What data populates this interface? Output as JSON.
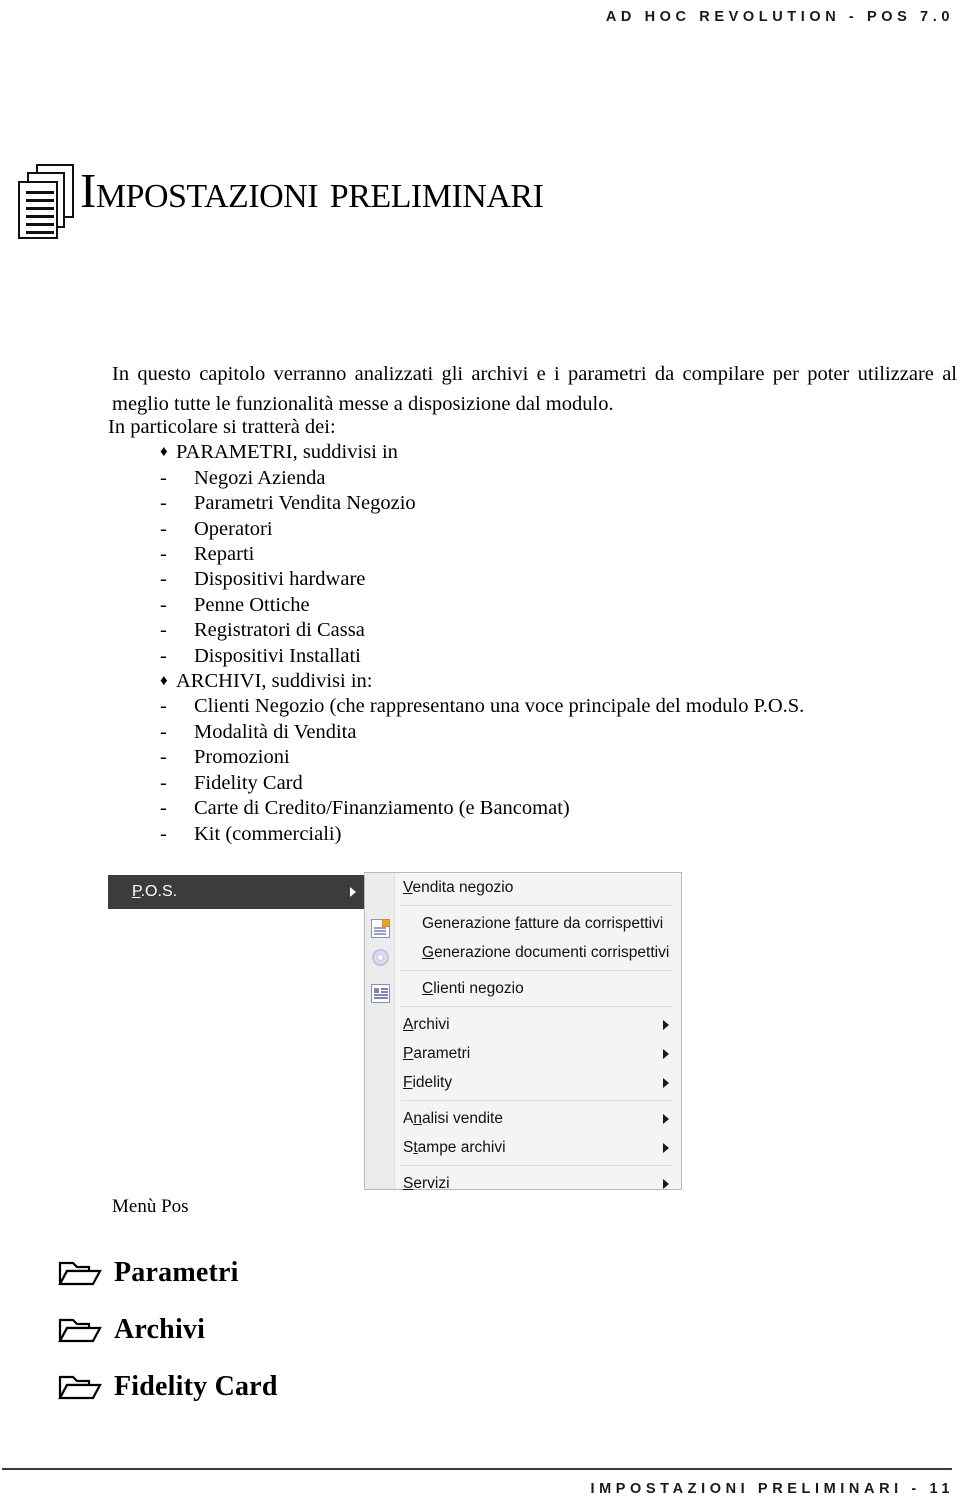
{
  "header": {
    "running_title": "AD HOC REVOLUTION - POS 7.0"
  },
  "chapter": {
    "icon": "stacked-pages-icon",
    "title": "Impostazioni preliminari"
  },
  "intro": {
    "paragraph": "In questo capitolo verranno analizzati gli archivi e i parametri da compilare per poter utilizzare al meglio tutte le funzionalità messe a disposizione dal modulo."
  },
  "list": {
    "lead_in": "In particolare si tratterà dei:",
    "bullet_mark": "♦",
    "dash_mark": "-",
    "groups": [
      {
        "heading": "PARAMETRI, suddivisi in",
        "items": [
          "Negozi Azienda",
          "Parametri Vendita Negozio",
          "Operatori",
          "Reparti",
          "Dispositivi hardware",
          "Penne Ottiche",
          "Registratori di Cassa",
          "Dispositivi Installati"
        ]
      },
      {
        "heading": "ARCHIVI, suddivisi in:",
        "items": [
          "Clienti Negozio (che rappresentano una voce principale del modulo P.O.S.",
          "Modalità di Vendita",
          "Promozioni",
          "Fidelity Card",
          "Carte di Credito/Finanziamento (e Bancomat)",
          "Kit (commerciali)"
        ]
      }
    ]
  },
  "menu_screenshot": {
    "parent_item": {
      "label_before": "P",
      "accel": ".",
      "label_full": "P.O.S.",
      "accel_letter": "P",
      "rest": ".O.S.",
      "has_submenu_arrow": true
    },
    "items": [
      {
        "accel": "V",
        "rest": "endita negozio",
        "pre": "",
        "icon": null,
        "arrow": false,
        "separator_before": false
      },
      {
        "accel": "f",
        "rest": "atture da corrispettivi",
        "pre": "Generazione ",
        "icon": "document-badge-icon",
        "arrow": false,
        "separator_before": true
      },
      {
        "accel": "G",
        "rest": "enerazione documenti corrispettivi",
        "pre": "",
        "icon": "gear-icon",
        "arrow": false,
        "separator_before": false
      },
      {
        "accel": "C",
        "rest": "lienti negozio",
        "pre": "",
        "icon": "list-card-icon",
        "arrow": false,
        "separator_before": true
      },
      {
        "accel": "A",
        "rest": "rchivi",
        "pre": "",
        "icon": null,
        "arrow": true,
        "separator_before": true
      },
      {
        "accel": "P",
        "rest": "arametri",
        "pre": "",
        "icon": null,
        "arrow": true,
        "separator_before": false
      },
      {
        "accel": "F",
        "rest": "idelity",
        "pre": "",
        "icon": null,
        "arrow": true,
        "separator_before": false
      },
      {
        "accel": "n",
        "rest": "alisi vendite",
        "pre": "A",
        "icon": null,
        "arrow": true,
        "separator_before": true
      },
      {
        "accel": "t",
        "rest": "ampe archivi",
        "pre": "S",
        "icon": null,
        "arrow": true,
        "separator_before": false
      },
      {
        "accel": "S",
        "rest": "ervizi",
        "pre": "",
        "icon": null,
        "arrow": true,
        "separator_before": true
      }
    ]
  },
  "figure": {
    "caption": "Menù Pos"
  },
  "sections": [
    {
      "icon": "open-folder-icon",
      "label": "Parametri"
    },
    {
      "icon": "open-folder-icon",
      "label": "Archivi"
    },
    {
      "icon": "open-folder-icon",
      "label": "Fidelity Card"
    }
  ],
  "footer": {
    "text": "IMPOSTAZIONI PRELIMINARI - 11"
  },
  "colors": {
    "menu_highlight": "#3c3c3c",
    "menu_background": "#f4f4f4",
    "menu_gutter": "#ececed",
    "menu_border": "#b9b9b9",
    "rule": "#3b3b42",
    "text": "#000000"
  }
}
